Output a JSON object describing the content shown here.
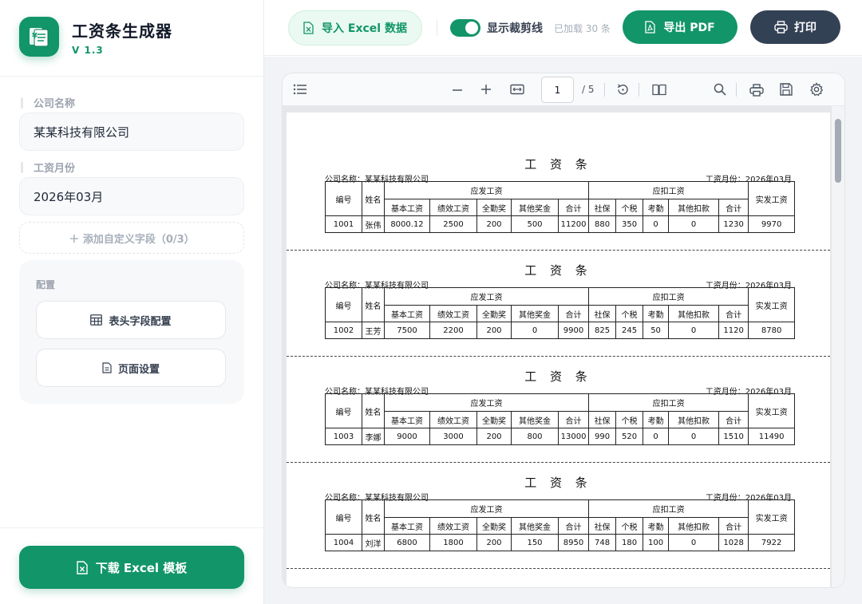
{
  "sidebar": {
    "app_title": "工资条生成器",
    "app_version": "V 1.3",
    "company_label": "公司名称",
    "company_value": "某某科技有限公司",
    "month_label": "工资月份",
    "month_value": "2026年03月",
    "add_field_label": "＋ 添加自定义字段（0/3）",
    "config_title": "配置",
    "header_config_label": "表头字段配置",
    "page_settings_label": "页面设置",
    "download_template_label": "下载 Excel 模板"
  },
  "topbar": {
    "import_label": "导入 Excel 数据",
    "toggle_label": "显示裁剪线",
    "toggle_on": true,
    "loaded_text": "已加载 30 条",
    "export_pdf_label": "导出 PDF",
    "print_label": "打印"
  },
  "viewer": {
    "page_number": "1",
    "page_total": "/ 5"
  },
  "slip_headers": {
    "title": "工 资 条",
    "company_prefix": "公司名称：",
    "month_prefix": "工资月份：",
    "id": "编号",
    "name": "姓名",
    "income_group": "应发工资",
    "deduction_group": "应扣工资",
    "net": "实发工资",
    "base": "基本工资",
    "performance": "绩效工资",
    "attendance_bonus": "全勤奖",
    "other_bonus": "其他奖金",
    "income_total": "合计",
    "social": "社保",
    "tax": "个税",
    "absence": "考勤",
    "other_deduction": "其他扣款",
    "deduction_total": "合计"
  },
  "slips": [
    {
      "company_line": "公司名称：某某科技有限公司",
      "month_line": "工资月份：2026年03月",
      "id": "1001",
      "name": "张伟",
      "base": "8000.12",
      "performance": "2500",
      "attendance_bonus": "200",
      "other_bonus": "500",
      "income_total": "11200",
      "social": "880",
      "tax": "350",
      "absence": "0",
      "other_deduction": "0",
      "deduction_total": "1230",
      "net": "9970"
    },
    {
      "company_line": "公司名称：某某科技有限公司",
      "month_line": "工资月份：2026年03月",
      "id": "1002",
      "name": "王芳",
      "base": "7500",
      "performance": "2200",
      "attendance_bonus": "200",
      "other_bonus": "0",
      "income_total": "9900",
      "social": "825",
      "tax": "245",
      "absence": "50",
      "other_deduction": "0",
      "deduction_total": "1120",
      "net": "8780"
    },
    {
      "company_line": "公司名称：某某科技有限公司",
      "month_line": "工资月份：2026年03月",
      "id": "1003",
      "name": "李娜",
      "base": "9000",
      "performance": "3000",
      "attendance_bonus": "200",
      "other_bonus": "800",
      "income_total": "13000",
      "social": "990",
      "tax": "520",
      "absence": "0",
      "other_deduction": "0",
      "deduction_total": "1510",
      "net": "11490"
    },
    {
      "company_line": "公司名称：某某科技有限公司",
      "month_line": "工资月份：2026年03月",
      "id": "1004",
      "name": "刘洋",
      "base": "6800",
      "performance": "1800",
      "attendance_bonus": "200",
      "other_bonus": "150",
      "income_total": "8950",
      "social": "748",
      "tax": "180",
      "absence": "100",
      "other_deduction": "0",
      "deduction_total": "1028",
      "net": "7922"
    }
  ],
  "colors": {
    "accent": "#129569",
    "dark_button": "#334155"
  }
}
